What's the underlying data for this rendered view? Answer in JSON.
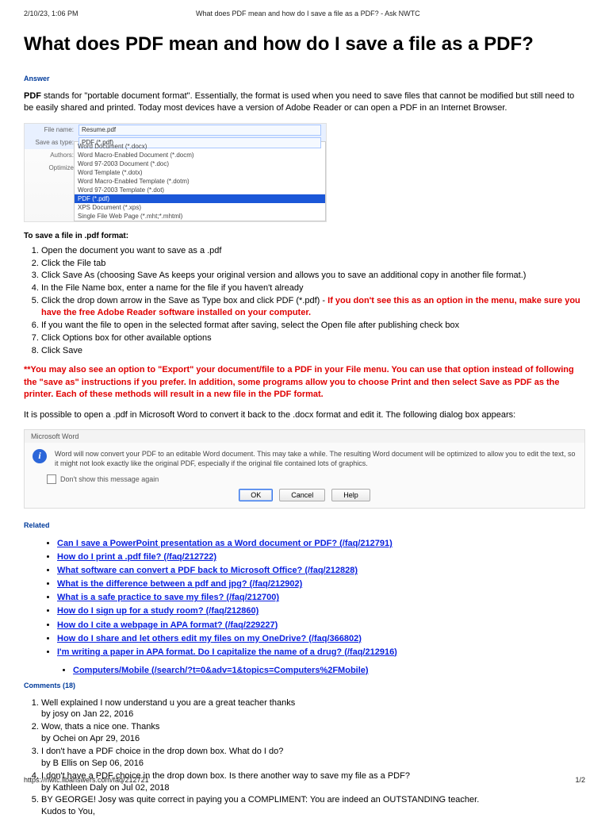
{
  "print": {
    "datetime": "2/10/23, 1:06 PM",
    "title": "What does PDF mean and how do I save a file as a PDF? - Ask NWTC"
  },
  "heading": "What does PDF mean and how do I save a file as a PDF?",
  "labels": {
    "answer": "Answer",
    "related": "Related",
    "comments": "Comments (18)"
  },
  "intro_bold": "PDF",
  "intro_rest": " stands for \"portable document format\".  Essentially, the format is used when you need to save files that cannot be modified but still need to be easily shared and printed.  Today most devices have a version of Adobe Reader or can open a PDF in an Internet Browser.",
  "savebox": {
    "filename_label": "File name:",
    "filename_value": "Resume.pdf",
    "saveas_label": "Save as type:",
    "saveas_value": "PDF (*.pdf)",
    "authors_label": "Authors:",
    "optimize_label": "Optimize",
    "options_list": [
      "Word Document (*.docx)",
      "Word Macro-Enabled Document (*.docm)",
      "Word 97-2003 Document (*.doc)",
      "Word Template (*.dotx)",
      "Word Macro-Enabled Template (*.dotm)",
      "Word 97-2003 Template (*.dot)",
      "PDF (*.pdf)",
      "XPS Document (*.xps)",
      "Single File Web Page (*.mht;*.mhtml)"
    ],
    "hi_index": 6
  },
  "subhead": "To save a file in .pdf format:",
  "steps": [
    {
      "pre": "Open the document you want to save as a .pdf"
    },
    {
      "pre": "Click the File tab"
    },
    {
      "pre": "Click Save As (choosing Save As keeps your original version and allows you to save an additional copy in another file format.)"
    },
    {
      "pre": "In the File Name box, enter a name for the file if you haven't already"
    },
    {
      "pre": "Click the drop down arrow in the Save as Type box and click PDF (*.pdf) - ",
      "red": "If you don't see this as an option in the menu, make sure you have the free Adobe Reader software installed on your computer."
    },
    {
      "pre": "If you want the file to open in the selected format after saving, select the Open file after publishing check box"
    },
    {
      "pre": "Click Options box for other available options"
    },
    {
      "pre": "Click Save"
    }
  ],
  "note_red": "**You may also see an option to \"Export\" your document/file to a PDF in your File menu. You can use that option instead of following the \"save as\" instructions if you prefer. In addition, some programs allow you to choose Print and then select Save as PDF as the printer. Each of these methods will result in a new file in the PDF format.",
  "convert_line": "It is possible to open a .pdf in Microsoft Word to convert it back to the .docx format and edit it. The following dialog box appears:",
  "word": {
    "title": "Microsoft Word",
    "msg": "Word will now convert your PDF to an editable Word document. This may take a while. The resulting Word document will be optimized to allow you to edit the text, so it might not look exactly like the original PDF, especially if the original file contained lots of graphics.",
    "chk": "Don't show this message again",
    "ok": "OK",
    "cancel": "Cancel",
    "help": "Help"
  },
  "related": [
    "Can I save a PowerPoint presentation as a Word document or PDF? (/faq/212791)",
    "How do I print a .pdf file? (/faq/212722)",
    "What software can convert a PDF back to Microsoft Office? (/faq/212828)",
    "What is the difference between a pdf and jpg? (/faq/212902)",
    "What is a safe practice to save my files? (/faq/212700)",
    "How do I sign up for a study room? (/faq/212860)",
    "How do I cite a webpage in APA format? (/faq/229227)",
    "How do I share and let others edit my files on my OneDrive? (/faq/366802)",
    "I'm writing a paper in APA format. Do I capitalize the name of a drug? (/faq/212916)"
  ],
  "rel_topic": "Computers/Mobile (/search/?t=0&adv=1&topics=Computers%2FMobile)",
  "comments": [
    {
      "t": "Well explained I now understand u you are a great teacher thanks",
      "by": "by josy on Jan 22, 2016"
    },
    {
      "t": "Wow, thats a nice one. Thanks",
      "by": "by Ochei on Apr 29, 2016"
    },
    {
      "t": "I don't have a PDF choice in the drop down box. What do I do?",
      "by": "by B Ellis on Sep 06, 2016"
    },
    {
      "t": "I don't have a PDF choice in the drop down box. Is there another way to save my file as a PDF?",
      "by": "by Kathleen Daly on Jul 02, 2018"
    },
    {
      "t": "BY GEORGE! Josy was quite correct in paying you a COMPLIMENT: You are indeed an OUTSTANDING teacher.",
      "t2": "Kudos to You,"
    }
  ],
  "footer": {
    "url": "https://nwtc.libanswers.com/faq/212721",
    "page": "1/2"
  }
}
